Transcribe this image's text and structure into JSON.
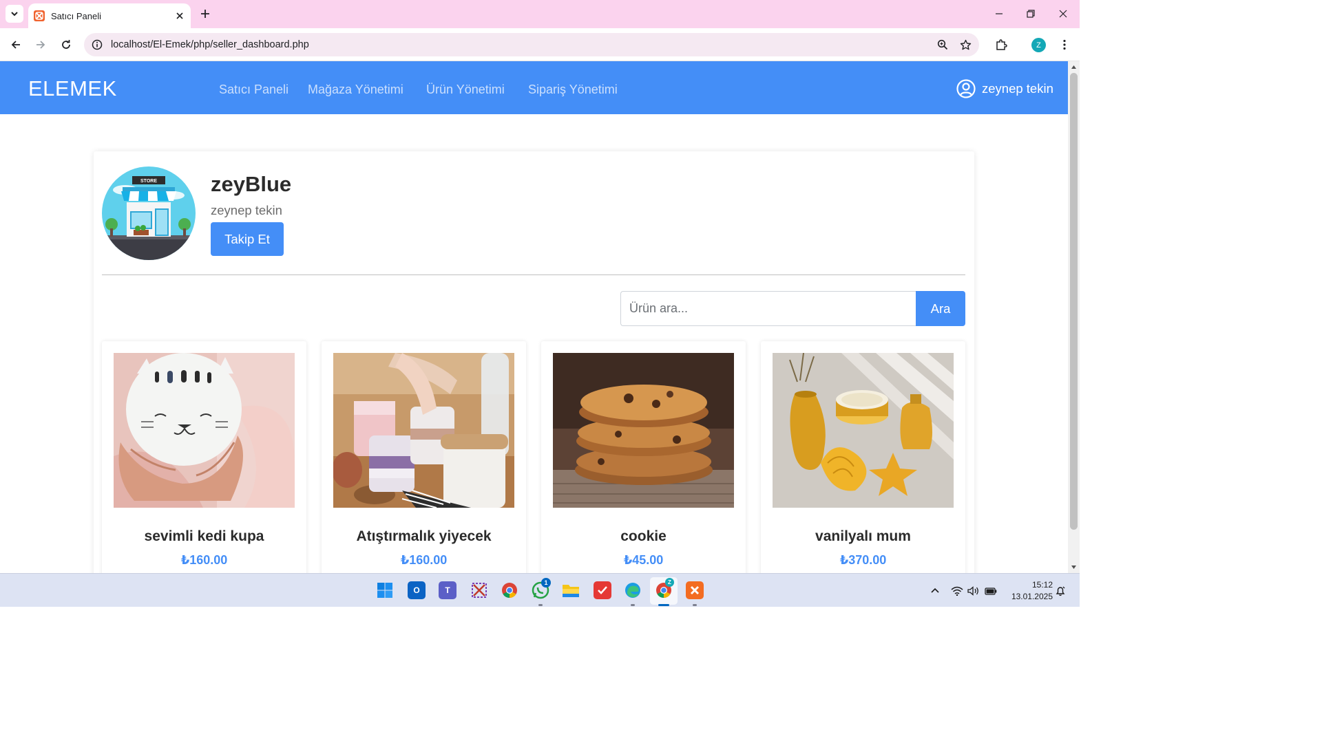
{
  "browser": {
    "tab_title": "Satıcı Paneli",
    "url": "localhost/El-Emek/php/seller_dashboard.php",
    "profile_initial": "Z"
  },
  "site": {
    "brand": "ELEMEK",
    "nav": [
      "Satıcı Paneli",
      "Mağaza Yönetimi",
      "Ürün Yönetimi",
      "Sipariş Yönetimi"
    ],
    "user_name": "zeynep tekin"
  },
  "shop": {
    "store_sign": "STORE",
    "name": "zeyBlue",
    "owner": "zeynep tekin",
    "follow_label": "Takip Et"
  },
  "search": {
    "placeholder": "Ürün ara...",
    "button_label": "Ara"
  },
  "products": [
    {
      "name": "sevimli kedi kupa",
      "price": "₺160.00",
      "image": "cat-mug-photo"
    },
    {
      "name": "Atıştırmalık yiyecek",
      "price": "₺160.00",
      "image": "snack-jars-photo"
    },
    {
      "name": "cookie",
      "price": "₺45.00",
      "image": "cookie-stack-photo"
    },
    {
      "name": "vanilyalı mum",
      "price": "₺370.00",
      "image": "gold-candle-photo"
    }
  ],
  "taskbar": {
    "whatsapp_badge": "1",
    "chrome_profile_badge": "Z",
    "time": "15:12",
    "date": "13.01.2025"
  },
  "colors": {
    "accent": "#448ef7",
    "tabstrip": "#fbd3ee",
    "taskbar": "#dde3f3"
  }
}
